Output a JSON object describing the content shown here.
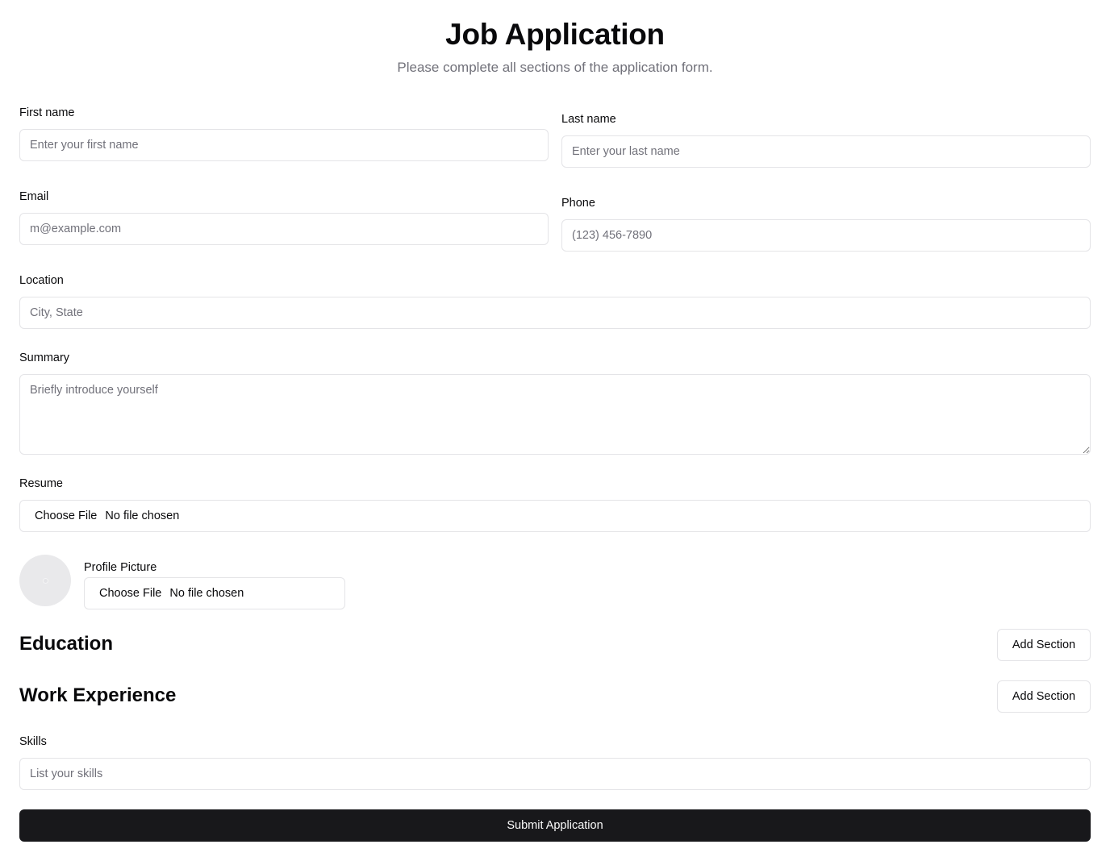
{
  "header": {
    "title": "Job Application",
    "subtitle": "Please complete all sections of the application form."
  },
  "fields": {
    "first_name": {
      "label": "First name",
      "value": "",
      "placeholder": "Enter your first name"
    },
    "last_name": {
      "label": "Last name",
      "value": "",
      "placeholder": "Enter your last name"
    },
    "email": {
      "label": "Email",
      "value": "",
      "placeholder": "m@example.com"
    },
    "phone": {
      "label": "Phone",
      "value": "",
      "placeholder": "(123) 456-7890"
    },
    "location": {
      "label": "Location",
      "value": "",
      "placeholder": "City, State"
    },
    "summary": {
      "label": "Summary",
      "value": "",
      "placeholder": "Briefly introduce yourself"
    },
    "skills": {
      "label": "Skills",
      "value": "",
      "placeholder": "List your skills"
    }
  },
  "resume": {
    "label": "Resume",
    "button": "Choose File",
    "status": "No file chosen"
  },
  "profile_picture": {
    "label": "Profile Picture",
    "button": "Choose File",
    "status": "No file chosen",
    "icon": "avatar-placeholder-icon"
  },
  "sections": {
    "education": {
      "title": "Education",
      "add_label": "Add Section"
    },
    "work_experience": {
      "title": "Work Experience",
      "add_label": "Add Section"
    }
  },
  "submit_label": "Submit Application",
  "colors": {
    "primary_button": "#18181b",
    "border": "#e4e4e7",
    "muted_text": "#71717a",
    "avatar_bg": "#e9e9eb"
  }
}
